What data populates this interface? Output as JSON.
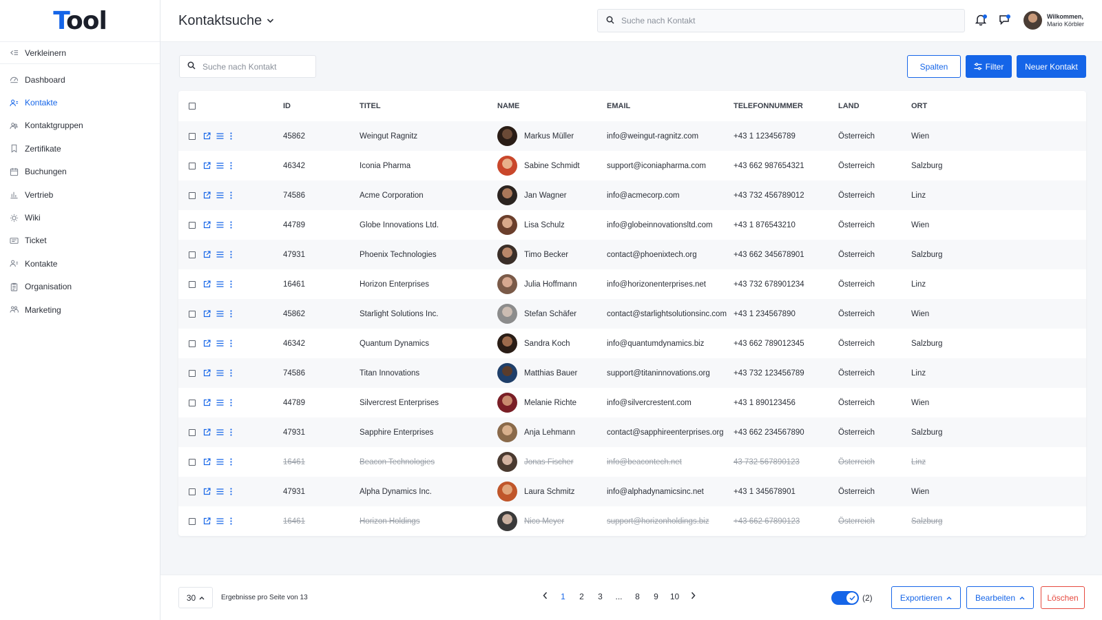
{
  "brand": {
    "logo_first": "T",
    "logo_rest": "ool"
  },
  "sidebar": {
    "collapse_label": "Verkleinern",
    "items": [
      {
        "label": "Dashboard",
        "icon": "dashboard-icon",
        "active": false
      },
      {
        "label": "Kontakte",
        "icon": "contacts-icon",
        "active": true
      },
      {
        "label": "Kontaktgruppen",
        "icon": "contact-groups-icon",
        "active": false
      },
      {
        "label": "Zertifikate",
        "icon": "bookmark-icon",
        "active": false
      },
      {
        "label": "Buchungen",
        "icon": "calendar-icon",
        "active": false
      },
      {
        "label": "Vertrieb",
        "icon": "bar-chart-icon",
        "active": false
      },
      {
        "label": "Wiki",
        "icon": "lightbulb-icon",
        "active": false
      },
      {
        "label": "Ticket",
        "icon": "ticket-icon",
        "active": false
      },
      {
        "label": "Kontakte",
        "icon": "contacts-icon",
        "active": false
      },
      {
        "label": "Organisation",
        "icon": "clipboard-icon",
        "active": false
      },
      {
        "label": "Marketing",
        "icon": "users-icon",
        "active": false
      }
    ]
  },
  "header": {
    "title": "Kontaktsuche",
    "search_placeholder": "Suche nach Kontakt",
    "user_greeting": "Wilkommen,",
    "user_name": "Mario Körbler"
  },
  "toolbar": {
    "search_placeholder": "Suche nach Kontakt",
    "columns_label": "Spalten",
    "filter_label": "Filter",
    "new_contact_label": "Neuer Kontakt"
  },
  "table": {
    "columns": [
      "ID",
      "TITEL",
      "NAME",
      "EMAIL",
      "TELEFONNUMMER",
      "LAND",
      "ORT"
    ],
    "rows": [
      {
        "id": "45862",
        "title": "Weingut Ragnitz",
        "name": "Markus Müller",
        "email": "info@weingut-ragnitz.com",
        "phone": "+43 1 123456789",
        "country": "Österreich",
        "city": "Wien",
        "struck": false
      },
      {
        "id": "46342",
        "title": "Iconia Pharma",
        "name": "Sabine Schmidt",
        "email": "support@iconiapharma.com",
        "phone": "+43 662 987654321",
        "country": "Österreich",
        "city": "Salzburg",
        "struck": false
      },
      {
        "id": "74586",
        "title": "Acme Corporation",
        "name": "Jan Wagner",
        "email": "info@acmecorp.com",
        "phone": "+43 732 456789012",
        "country": "Österreich",
        "city": "Linz",
        "struck": false
      },
      {
        "id": "44789",
        "title": "Globe Innovations Ltd.",
        "name": "Lisa Schulz",
        "email": "info@globeinnovationsltd.com",
        "phone": "+43 1 876543210",
        "country": "Österreich",
        "city": "Wien",
        "struck": false
      },
      {
        "id": "47931",
        "title": "Phoenix Technologies",
        "name": "Timo  Becker",
        "email": "contact@phoenixtech.org",
        "phone": "+43 662 345678901",
        "country": "Österreich",
        "city": "Salzburg",
        "struck": false
      },
      {
        "id": "16461",
        "title": "Horizon Enterprises",
        "name": "Julia Hoffmann",
        "email": "info@horizonenterprises.net",
        "phone": "+43 732 678901234",
        "country": "Österreich",
        "city": "Linz",
        "struck": false
      },
      {
        "id": "45862",
        "title": "Starlight Solutions Inc.",
        "name": "Stefan Schäfer",
        "email": "contact@starlightsolutionsinc.com",
        "phone": "+43 1 234567890",
        "country": "Österreich",
        "city": "Wien",
        "struck": false
      },
      {
        "id": "46342",
        "title": "Quantum Dynamics",
        "name": "Sandra Koch",
        "email": "info@quantumdynamics.biz",
        "phone": "+43 662 789012345",
        "country": "Österreich",
        "city": "Salzburg",
        "struck": false
      },
      {
        "id": "74586",
        "title": "Titan Innovations",
        "name": "Matthias Bauer",
        "email": "support@titaninnovations.org",
        "phone": "+43 732 123456789",
        "country": "Österreich",
        "city": "Linz",
        "struck": false
      },
      {
        "id": "44789",
        "title": "Silvercrest Enterprises",
        "name": "Melanie Richte",
        "email": " info@silvercrestent.com",
        "phone": "+43 1 890123456",
        "country": "Österreich",
        "city": "Wien",
        "struck": false
      },
      {
        "id": "47931",
        "title": "Sapphire Enterprises",
        "name": "Anja Lehmann",
        "email": "contact@sapphireenterprises.org",
        "phone": "+43 662 234567890",
        "country": "Österreich",
        "city": "Salzburg",
        "struck": false
      },
      {
        "id": "16461",
        "title": "Beacon Technologies",
        "name": "Jonas Fischer",
        "email": "info@beacontech.net",
        "phone": "43 732 567890123",
        "country": "Österreich",
        "city": "Linz",
        "struck": true
      },
      {
        "id": "47931",
        "title": "Alpha Dynamics Inc.",
        "name": "Laura Schmitz",
        "email": " info@alphadynamicsinc.net",
        "phone": "+43 1 345678901",
        "country": "Österreich",
        "city": "Wien",
        "struck": false
      },
      {
        "id": "16461",
        "title": "Horizon Holdings",
        "name": "Nico Meyer",
        "email": "support@horizonholdings.biz",
        "phone": "+43 662 67890123",
        "country": "Österreich",
        "city": "Salzburg",
        "struck": true
      }
    ]
  },
  "footer": {
    "per_page": "30",
    "per_page_text": "Ergebnisse pro Seite von 13",
    "pages": [
      "1",
      "2",
      "3",
      "...",
      "8",
      "9",
      "10"
    ],
    "current_page": "1",
    "toggle_count": "(2)",
    "export_label": "Exportieren",
    "edit_label": "Bearbeiten",
    "delete_label": "Löschen"
  },
  "colors": {
    "accent": "#1565e8",
    "danger": "#e6483d",
    "avatar_skin": "#c99a7a",
    "avatar_hair": "#3b2c22"
  }
}
